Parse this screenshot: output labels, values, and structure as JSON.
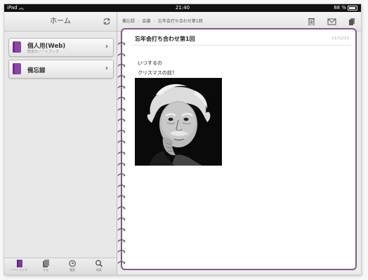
{
  "status_bar": {
    "device": "iPad",
    "time": "21:40",
    "battery": "88 %"
  },
  "sidebar": {
    "title": "ホーム",
    "notebooks": [
      {
        "name": "個人用(Web)",
        "subtitle": "既定のノートブック"
      },
      {
        "name": "備忘録",
        "subtitle": ""
      }
    ],
    "tabs": [
      {
        "label": "ノートブック",
        "icon": "notebook-icon"
      },
      {
        "label": "メモ",
        "icon": "notes-icon"
      },
      {
        "label": "履歴",
        "icon": "clock-icon"
      },
      {
        "label": "検索",
        "icon": "search-icon"
      }
    ]
  },
  "toolbar": {
    "breadcrumbs": [
      "備忘録",
      "会議",
      "忘年会打ち合わせ第1回"
    ],
    "icons": [
      "trash-icon",
      "mail-icon",
      "share-icon"
    ]
  },
  "page": {
    "title": "忘年会打ち合わせ第1回",
    "date": "11/12/13",
    "lines": [
      "いつするの",
      "クリスマスの前？"
    ],
    "image": "portrait-photo"
  },
  "colors": {
    "accent": "#7c5b8a",
    "notebook": "#8a45a6",
    "status_bar": "#111111"
  }
}
